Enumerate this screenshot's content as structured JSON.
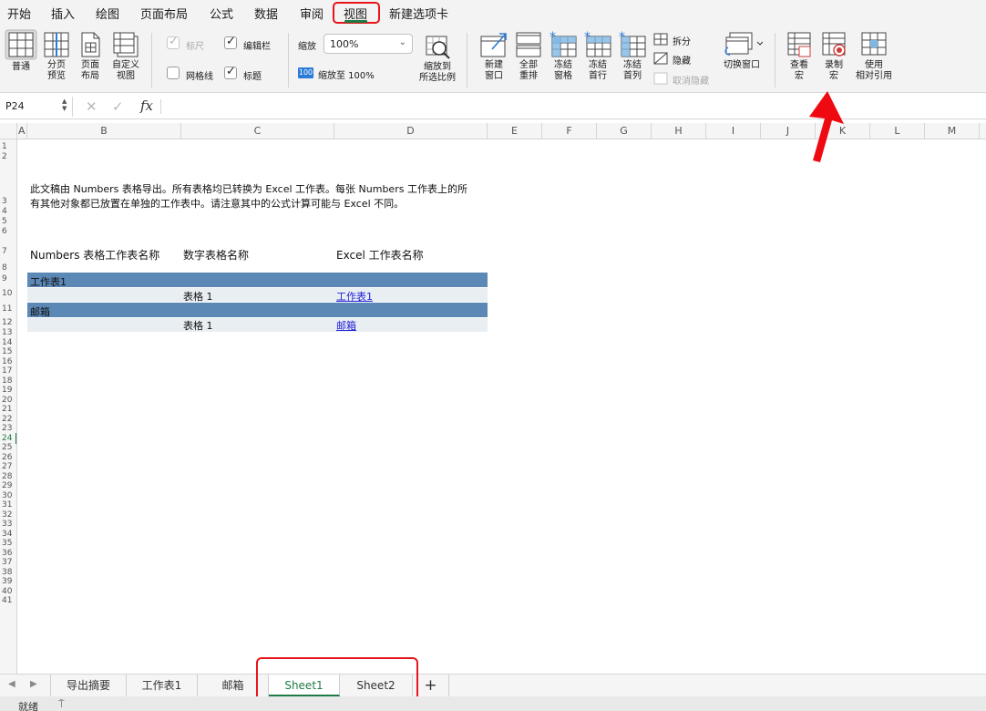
{
  "ribbon_tabs": [
    {
      "label": "开始"
    },
    {
      "label": "插入"
    },
    {
      "label": "绘图"
    },
    {
      "label": "页面布局"
    },
    {
      "label": "公式"
    },
    {
      "label": "数据"
    },
    {
      "label": "审阅"
    },
    {
      "label": "视图",
      "selected": true
    },
    {
      "label": "新建选项卡"
    }
  ],
  "ribbon": {
    "views": {
      "normal": "普通",
      "page_break_1": "分页",
      "page_break_2": "预览",
      "page_layout_1": "页面",
      "page_layout_2": "布局",
      "custom_1": "自定义",
      "custom_2": "视图"
    },
    "show": {
      "ruler": {
        "label": "标尺",
        "checked": true,
        "disabled": true
      },
      "formula_bar": {
        "label": "编辑栏",
        "checked": true
      },
      "gridlines": {
        "label": "网格线",
        "checked": false
      },
      "headings": {
        "label": "标题",
        "checked": true
      }
    },
    "zoom": {
      "label": "缩放",
      "value": "100%",
      "reset_label": "缩放至 100%",
      "reset_badge": "100",
      "fit_1": "缩放到",
      "fit_2": "所选比例"
    },
    "window": {
      "new_1": "新建",
      "new_2": "窗口",
      "arrange_1": "全部",
      "arrange_2": "重排",
      "freeze_panes_1": "冻结",
      "freeze_panes_2": "窗格",
      "freeze_row_1": "冻结",
      "freeze_row_2": "首行",
      "freeze_col_1": "冻结",
      "freeze_col_2": "首列",
      "split": "拆分",
      "hide": "隐藏",
      "unhide": "取消隐藏",
      "switch": "切换窗口"
    },
    "macros": {
      "view_1": "查看",
      "view_2": "宏",
      "record_1": "录制",
      "record_2": "宏",
      "relative_1": "使用",
      "relative_2": "相对引用"
    }
  },
  "formula_bar": {
    "name_box": "P24",
    "cancel": "✕",
    "confirm": "✓",
    "fx": "fx",
    "content": ""
  },
  "columns": [
    "A",
    "B",
    "C",
    "D",
    "E",
    "F",
    "G",
    "H",
    "I",
    "J",
    "K",
    "L",
    "M"
  ],
  "rows": [
    "1",
    "2",
    "3",
    "4",
    "5",
    "6",
    "7",
    "8",
    "9",
    "10",
    "11",
    "12",
    "13",
    "14",
    "15",
    "16",
    "17",
    "18",
    "19",
    "20",
    "21",
    "22",
    "23",
    "24",
    "25",
    "26",
    "27",
    "28",
    "29",
    "30",
    "31",
    "32",
    "33",
    "34",
    "35",
    "36",
    "37",
    "38",
    "39",
    "40",
    "41"
  ],
  "selected_row": "24",
  "sheet": {
    "note_line1": "此文稿由 Numbers 表格导出。所有表格均已转换为 Excel 工作表。每张 Numbers 工作表上的所",
    "note_line2": "有其他对象都已放置在单独的工作表中。请注意其中的公式计算可能与 Excel 不同。",
    "hdr_numbers_sheet": "Numbers 表格工作表名称",
    "hdr_table_name": "数字表格名称",
    "hdr_excel_sheet": "Excel 工作表名称",
    "group1_name": "工作表1",
    "row10_table": "表格 1",
    "row10_link": "工作表1",
    "group2_name": "邮箱",
    "row12_table": "表格 1",
    "row12_link": "邮箱"
  },
  "sheet_tabs": [
    {
      "label": "导出摘要"
    },
    {
      "label": "工作表1"
    },
    {
      "label": "邮箱"
    },
    {
      "label": "Sheet1",
      "active": true
    },
    {
      "label": "Sheet2"
    }
  ],
  "add_sheet": "+",
  "status": {
    "text": "就绪"
  },
  "colors": {
    "accent": "#1f7a46",
    "highlight": "#e8151c",
    "band": "#5b88b5",
    "link": "#2020d8"
  }
}
